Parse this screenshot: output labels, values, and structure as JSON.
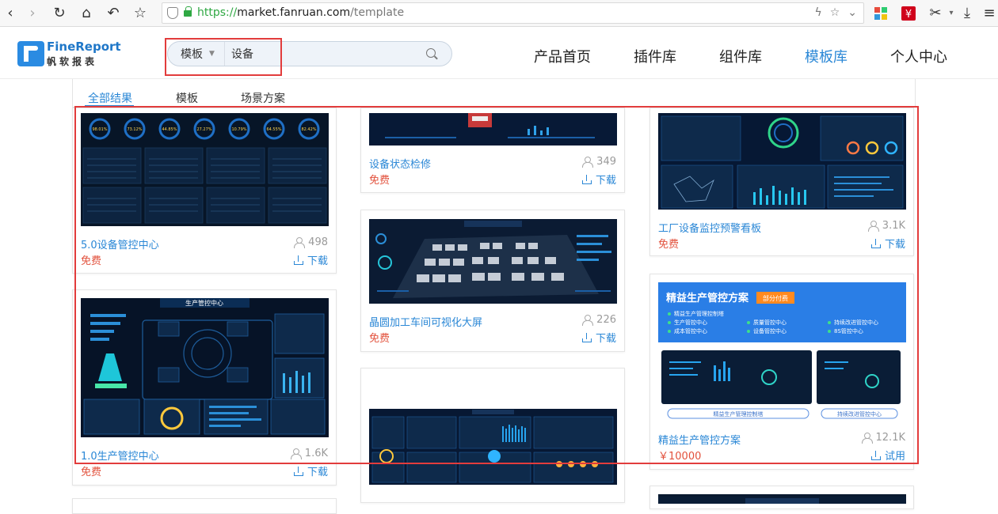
{
  "browser": {
    "url_scheme": "https://",
    "url_host": "market.fanruan.com",
    "url_path": "/template"
  },
  "logo": {
    "en": "FineReport",
    "cn": "帆软报表"
  },
  "search": {
    "category": "模板",
    "value": "设备"
  },
  "nav": [
    "产品首页",
    "插件库",
    "组件库",
    "模板库",
    "个人中心"
  ],
  "tabs": [
    "全部结果",
    "模板",
    "场景方案"
  ],
  "cards": [
    {
      "title": "5.0设备管控中心",
      "price": "免费",
      "views": "498",
      "action": "下载"
    },
    {
      "title": "1.0生产管控中心",
      "price": "免费",
      "views": "1.6K",
      "action": "下载",
      "thumb_title": "生产管控中心"
    },
    {
      "title": "设备状态检修",
      "price": "免费",
      "views": "349",
      "action": "下载"
    },
    {
      "title": "晶圆加工车间可视化大屏",
      "price": "免费",
      "views": "226",
      "action": "下载"
    },
    {
      "title": "工厂设备监控预警看板",
      "price": "免费",
      "views": "3.1K",
      "action": "下载"
    },
    {
      "title": "精益生产管控方案",
      "price": "￥10000",
      "views": "12.1K",
      "action": "试用",
      "thumb_title": "精益生产管控方案",
      "thumb_badge": "部分付费",
      "thumb_items": [
        "精益生产管理控制塔",
        "生产管控中心",
        "质量管控中心",
        "持续改进管控中心",
        "成本管控中心",
        "设备管控中心",
        "8S管控中心"
      ],
      "thumb_pills": [
        "精益生产管理控制塔",
        "持续改进管控中心"
      ]
    }
  ],
  "kpis": [
    "98.01%",
    "73.12%",
    "44.85%",
    "27.27%",
    "10.79%",
    "64.55%",
    "82.42%"
  ],
  "colors": {
    "accent": "#2a87d6",
    "price": "#e2513c",
    "highlight": "#e23c3c"
  }
}
